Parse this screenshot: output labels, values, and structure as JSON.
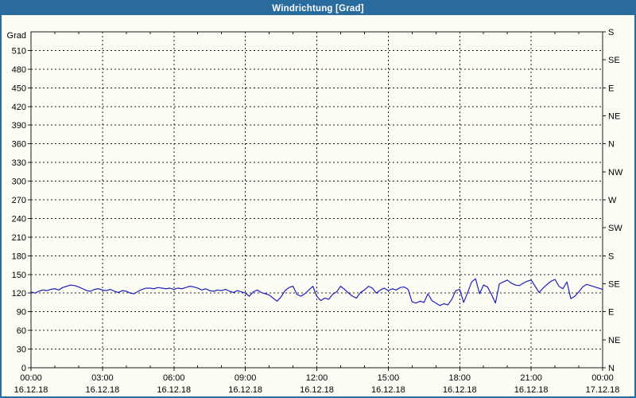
{
  "window": {
    "title": "Windrichtung [Grad]"
  },
  "colors": {
    "titlebar": "#2a6c9e",
    "window_border": "#2a6c9e",
    "background": "#fdfdf5",
    "plot_background": "#fdfdf5",
    "grid": "#1a1a1a",
    "line": "#1f1fbf",
    "title_text": "#ffffff",
    "label_text": "#000000"
  },
  "chart_data": {
    "type": "line",
    "title": "Windrichtung [Grad]",
    "ylabel_left": "Grad",
    "ylim": [
      0,
      540
    ],
    "y_left_ticks": [
      0,
      30,
      60,
      90,
      120,
      150,
      180,
      210,
      240,
      270,
      300,
      330,
      360,
      390,
      420,
      450,
      480,
      510
    ],
    "y_right_ticks": [
      {
        "value": 0,
        "label": "N"
      },
      {
        "value": 45,
        "label": "NE"
      },
      {
        "value": 90,
        "label": "E"
      },
      {
        "value": 135,
        "label": "SE"
      },
      {
        "value": 180,
        "label": "S"
      },
      {
        "value": 225,
        "label": "SW"
      },
      {
        "value": 270,
        "label": "W"
      },
      {
        "value": 315,
        "label": "NW"
      },
      {
        "value": 360,
        "label": "N"
      },
      {
        "value": 405,
        "label": "NE"
      },
      {
        "value": 450,
        "label": "E"
      },
      {
        "value": 495,
        "label": "SE"
      },
      {
        "value": 540,
        "label": "S"
      }
    ],
    "xlim_hours": [
      0,
      24
    ],
    "x_minor_step_hours": 1,
    "x_major_ticks": [
      {
        "hour": 0,
        "time": "00:00",
        "date": "16.12.18"
      },
      {
        "hour": 3,
        "time": "03:00",
        "date": "16.12.18"
      },
      {
        "hour": 6,
        "time": "06:00",
        "date": "16.12.18"
      },
      {
        "hour": 9,
        "time": "09:00",
        "date": "16.12.18"
      },
      {
        "hour": 12,
        "time": "12:00",
        "date": "16.12.18"
      },
      {
        "hour": 15,
        "time": "15:00",
        "date": "16.12.18"
      },
      {
        "hour": 18,
        "time": "18:00",
        "date": "16.12.18"
      },
      {
        "hour": 21,
        "time": "21:00",
        "date": "16.12.18"
      },
      {
        "hour": 24,
        "time": "00:00",
        "date": "17.12.18"
      }
    ],
    "grid": "dashed",
    "legend": "none",
    "series": [
      {
        "name": "Windrichtung",
        "unit": "Grad",
        "sample_interval_minutes": 10,
        "values": [
          122,
          120,
          123,
          125,
          124,
          126,
          127,
          125,
          129,
          131,
          133,
          132,
          130,
          127,
          124,
          123,
          126,
          127,
          125,
          124,
          126,
          123,
          121,
          124,
          123,
          120,
          119,
          123,
          126,
          128,
          128,
          127,
          129,
          128,
          127,
          128,
          126,
          128,
          127,
          129,
          131,
          130,
          128,
          125,
          127,
          124,
          123,
          125,
          124,
          126,
          123,
          121,
          124,
          122,
          120,
          115,
          122,
          125,
          121,
          119,
          117,
          112,
          107,
          114,
          124,
          129,
          131,
          118,
          115,
          119,
          125,
          131,
          115,
          108,
          112,
          110,
          118,
          122,
          131,
          126,
          120,
          115,
          112,
          121,
          125,
          131,
          128,
          120,
          125,
          128,
          124,
          127,
          125,
          129,
          130,
          126,
          106,
          104,
          107,
          105,
          119,
          108,
          104,
          100,
          103,
          101,
          110,
          124,
          126,
          105,
          121,
          138,
          143,
          119,
          133,
          130,
          118,
          104,
          135,
          138,
          141,
          136,
          133,
          132,
          136,
          139,
          141,
          131,
          121,
          128,
          134,
          139,
          142,
          131,
          127,
          138,
          111,
          115,
          122,
          130,
          134,
          132,
          130,
          128,
          126
        ]
      }
    ]
  }
}
